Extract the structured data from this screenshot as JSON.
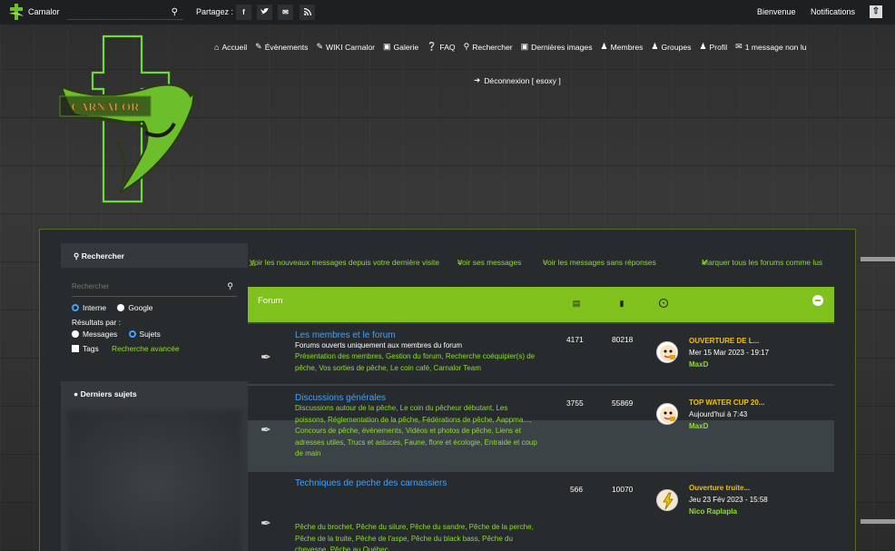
{
  "topbar": {
    "brand": "Carnalor",
    "search_placeholder": "",
    "share_label": "Partagez :",
    "share_buttons": [
      "f",
      "t",
      "✉",
      "rss"
    ],
    "welcome": "Bienvenue",
    "notifications": "Notifications"
  },
  "nav": {
    "items": [
      {
        "icon": "home-icon",
        "label": "Accueil"
      },
      {
        "icon": "pencil-icon",
        "label": "Évènements"
      },
      {
        "icon": "pencil-icon",
        "label": "WIKI Carnalor"
      },
      {
        "icon": "picture-icon",
        "label": "Galerie"
      },
      {
        "icon": "question-icon",
        "label": "FAQ"
      },
      {
        "icon": "search-icon",
        "label": "Rechercher"
      },
      {
        "icon": "picture-icon",
        "label": "Dernières images"
      },
      {
        "icon": "members-icon",
        "label": "Membres"
      },
      {
        "icon": "groups-icon",
        "label": "Groupes"
      },
      {
        "icon": "profile-icon",
        "label": "Profil"
      },
      {
        "icon": "mail-icon",
        "label": "1 message non lu"
      }
    ],
    "logout": "Déconnexion [ esoxy ]"
  },
  "logo_text": "CARNALOR",
  "sidebar": {
    "search_title": "Rechercher",
    "search_placeholder": "Rechercher",
    "engine_internal": "Interne",
    "engine_google": "Google",
    "results_label": "Résultats par :",
    "results_messages": "Messages",
    "results_subjects": "Sujets",
    "tags_label": "Tags",
    "advanced_search": "Recherche avancée",
    "latest_title": "Derniers sujets"
  },
  "links": {
    "new_messages": "Voir les nouveaux messages depuis votre dernière visite",
    "my_messages": "Voir ses messages",
    "unanswered": "Voir les messages sans réponses",
    "mark_read": "Marquer tous les forums comme lus"
  },
  "forum_table": {
    "header_title": "Forum",
    "rows": [
      {
        "title": "Les membres et le forum",
        "description": "Forums ouverts uniquement aux membres du forum",
        "subforums": "Présentation des membres, Gestion du forum, Recherche coéquipier(s) de pêche, Vos sorties de pêche, Le coin café, Carnalor Team",
        "topics": "4171",
        "posts": "80218",
        "last_title": "OUVERTURE DE L...",
        "last_date": "Mer 15 Mar 2023 - 19:17",
        "last_user": "MaxD"
      },
      {
        "title": "Discussions générales",
        "description": "",
        "subforums": "Discussions autour de la pêche, Le coin du pêcheur débutant, Les poissons, Réglementation de la pêche, Fédérations de pêche, Aappma..., Concours de pêche, évènements, Vidéos et photos de pêche, Liens et adresses utiles, Trucs et astuces, Faune, flore et écologie, Entraide et coup de main",
        "topics": "3755",
        "posts": "55869",
        "last_title": "TOP WATER CUP 20...",
        "last_date": "Aujourd'hui à 7:43",
        "last_user": "MaxD"
      },
      {
        "title": "Techniques de peche des carnassiers",
        "description": "",
        "subforums": "Pêche du brochet, Pêche du silure, Pêche du sandre, Pêche de la perche, Pêche de la truite, Pêche de l'aspe, Pêche du black bass, Pêche du chevesne, Pêche au Québec",
        "topics": "566",
        "posts": "10070",
        "last_title": "Ouverture truite...",
        "last_date": "Jeu 23 Fév 2023 - 15:58",
        "last_user": "Nico Raplapla"
      }
    ]
  },
  "colors": {
    "accent_green": "#80c11d",
    "link_green": "#8fdc2e",
    "link_blue": "#3fa3ff",
    "last_post_yellow": "#f2c200",
    "topbar_bg": "#1d1f21"
  }
}
